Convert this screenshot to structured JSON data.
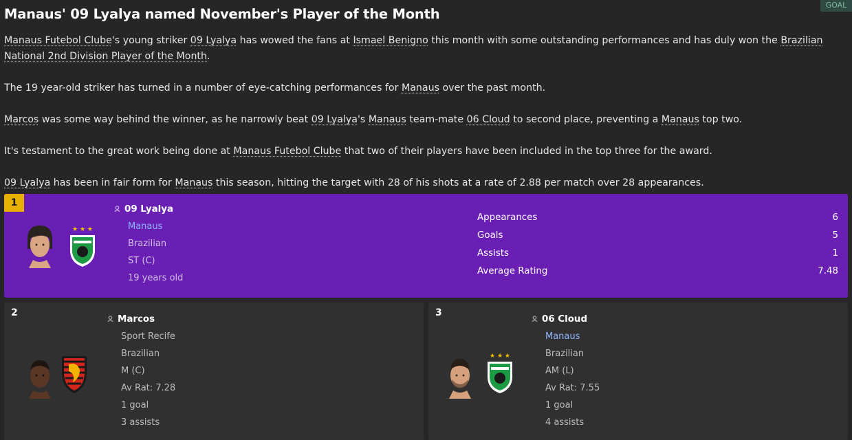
{
  "headline": "Manaus' 09 Lyalya named November's Player of the Month",
  "source_badge": "GOAL",
  "article": {
    "p1": [
      {
        "t": "Manaus Futebol Clube",
        "link": true
      },
      {
        "t": "'s young striker ",
        "link": false
      },
      {
        "t": "09 Lyalya",
        "link": true
      },
      {
        "t": " has wowed the fans at ",
        "link": false
      },
      {
        "t": "Ismael Benigno",
        "link": true
      },
      {
        "t": " this month with some outstanding performances and has duly won the ",
        "link": false
      },
      {
        "t": "Brazilian National 2nd Division Player of the Month",
        "link": true
      },
      {
        "t": ".",
        "link": false
      }
    ],
    "p2": [
      {
        "t": "The 19 year-old striker has turned in a number of eye-catching performances for ",
        "link": false
      },
      {
        "t": "Manaus",
        "link": true
      },
      {
        "t": " over the past month.",
        "link": false
      }
    ],
    "p3": [
      {
        "t": "Marcos",
        "link": true
      },
      {
        "t": " was some way behind the winner, as he narrowly beat ",
        "link": false
      },
      {
        "t": "09 Lyalya",
        "link": true
      },
      {
        "t": "'s ",
        "link": false
      },
      {
        "t": "Manaus",
        "link": true
      },
      {
        "t": " team-mate ",
        "link": false
      },
      {
        "t": "06 Cloud",
        "link": true
      },
      {
        "t": " to second place, preventing a ",
        "link": false
      },
      {
        "t": "Manaus",
        "link": true
      },
      {
        "t": " top two.",
        "link": false
      }
    ],
    "p4": [
      {
        "t": "It's testament to the great work being done at ",
        "link": false
      },
      {
        "t": "Manaus Futebol Clube",
        "link": true
      },
      {
        "t": " that two of their players have been included in the top three for the award.",
        "link": false
      }
    ],
    "p5": [
      {
        "t": "09 Lyalya",
        "link": true
      },
      {
        "t": " has been in fair form for ",
        "link": false
      },
      {
        "t": "Manaus",
        "link": true
      },
      {
        "t": " this season, hitting the target with 28 of his shots at a rate of 2.88 per match over 28 appearances.",
        "link": false
      }
    ]
  },
  "winner": {
    "rank": "1",
    "name": "09 Lyalya",
    "club": "Manaus",
    "nationality": "Brazilian",
    "position": "ST (C)",
    "age": "19 years old",
    "stats": [
      {
        "label": "Appearances",
        "value": "6"
      },
      {
        "label": "Goals",
        "value": "5"
      },
      {
        "label": "Assists",
        "value": "1"
      },
      {
        "label": "Average Rating",
        "value": "7.48"
      }
    ]
  },
  "second": {
    "rank": "2",
    "name": "Marcos",
    "club": "Sport Recife",
    "nationality": "Brazilian",
    "position": "M (C)",
    "rating": "Av Rat: 7.28",
    "goals": "1 goal",
    "assists": "3 assists"
  },
  "third": {
    "rank": "3",
    "name": "06 Cloud",
    "club": "Manaus",
    "nationality": "Brazilian",
    "position": "AM (L)",
    "rating": "Av Rat: 7.55",
    "goals": "1 goal",
    "assists": "4 assists"
  },
  "colors": {
    "winner_bg": "#6a1fb4",
    "rank_gold": "#e8b000",
    "club_link": "#8fb5ff"
  },
  "icons": {
    "person": "person-icon",
    "manaus_crest": "manaus-crest-icon",
    "sport_recife_crest": "sport-recife-crest-icon"
  }
}
